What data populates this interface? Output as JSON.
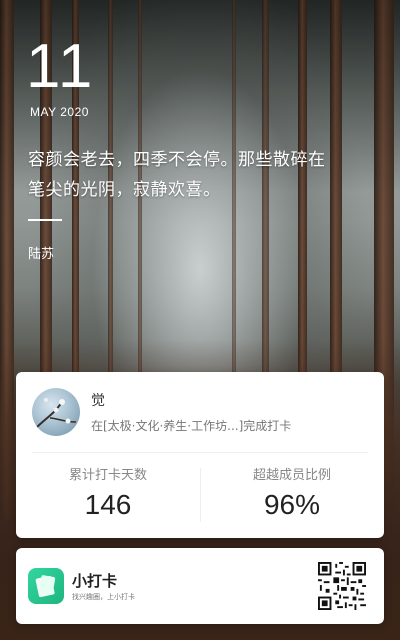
{
  "date": {
    "day": "11",
    "month_year": "MAY 2020"
  },
  "quote": {
    "line1": "容颜会老去，四季不会停。那些散碎在",
    "line2": "笔尖的光阴，寂静欢喜。",
    "author": "陆苏"
  },
  "user": {
    "name": "觉",
    "description": "在[太极·文化·养生·工作坊...]完成打卡"
  },
  "stats": {
    "days_label": "累计打卡天数",
    "days_value": "146",
    "ratio_label": "超越成员比例",
    "ratio_value": "96%"
  },
  "app": {
    "name": "小打卡",
    "slogan": "找兴趣圈，上小打卡",
    "accent": "#2bcc94"
  },
  "icons": {
    "avatar": "blossom-branch-avatar",
    "logo": "notebook-icon",
    "qr": "qr-code-icon"
  }
}
